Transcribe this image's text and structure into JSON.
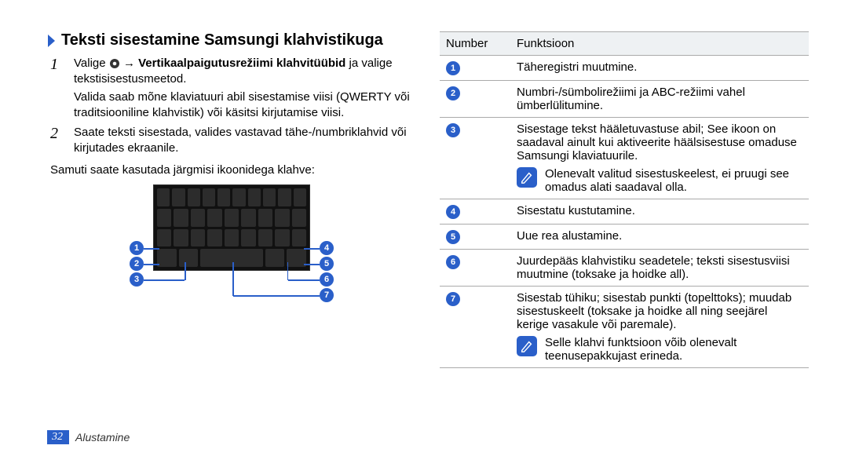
{
  "heading": "Teksti sisestamine Samsungi klahvistikuga",
  "step1": {
    "pre": "Valige ",
    "arrow": " → ",
    "bold": "Vertikaalpaigutusrežiimi klahvitüübid",
    "post1": " ja valige tekstisisestusmeetod.",
    "para2": "Valida saab mõne klaviatuuri abil sisestamise viisi (QWERTY või traditsiooniline klahvistik) või käsitsi kirjutamise viisi."
  },
  "step2": "Saate teksti sisestada, valides vastavad tähe-/numbriklahvid või kirjutades ekraanile.",
  "after_steps": "Samuti saate kasutada järgmisi ikoonidega klahve:",
  "table": {
    "header": {
      "c1": "Number",
      "c2": "Funktsioon"
    },
    "rows": [
      {
        "n": "1",
        "text": "Täheregistri muutmine."
      },
      {
        "n": "2",
        "text": "Numbri-/sümbolirežiimi ja ABC-režiimi vahel ümberlülitumine."
      },
      {
        "n": "3",
        "text": "Sisestage tekst hääletuvastuse abil; See ikoon on saadaval ainult kui aktiveerite häälsisestuse omaduse Samsungi klaviatuurile.",
        "note": "Olenevalt valitud sisestuskeelest, ei pruugi see omadus alati saadaval olla."
      },
      {
        "n": "4",
        "text": "Sisestatu kustutamine."
      },
      {
        "n": "5",
        "text": "Uue rea alustamine."
      },
      {
        "n": "6",
        "text": "Juurdepääs klahvistiku seadetele; teksti sisestusviisi muutmine (toksake ja hoidke all)."
      },
      {
        "n": "7",
        "text": "Sisestab tühiku; sisestab punkti (topelttoks); muudab sisestuskeelt (toksake ja hoidke all ning seejärel kerige vasakule või paremale).",
        "note": "Selle klahvi funktsioon võib olenevalt teenusepakkujast erineda."
      }
    ]
  },
  "callout_labels": [
    "1",
    "2",
    "3",
    "4",
    "5",
    "6",
    "7"
  ],
  "footer": {
    "page": "32",
    "section": "Alustamine"
  }
}
